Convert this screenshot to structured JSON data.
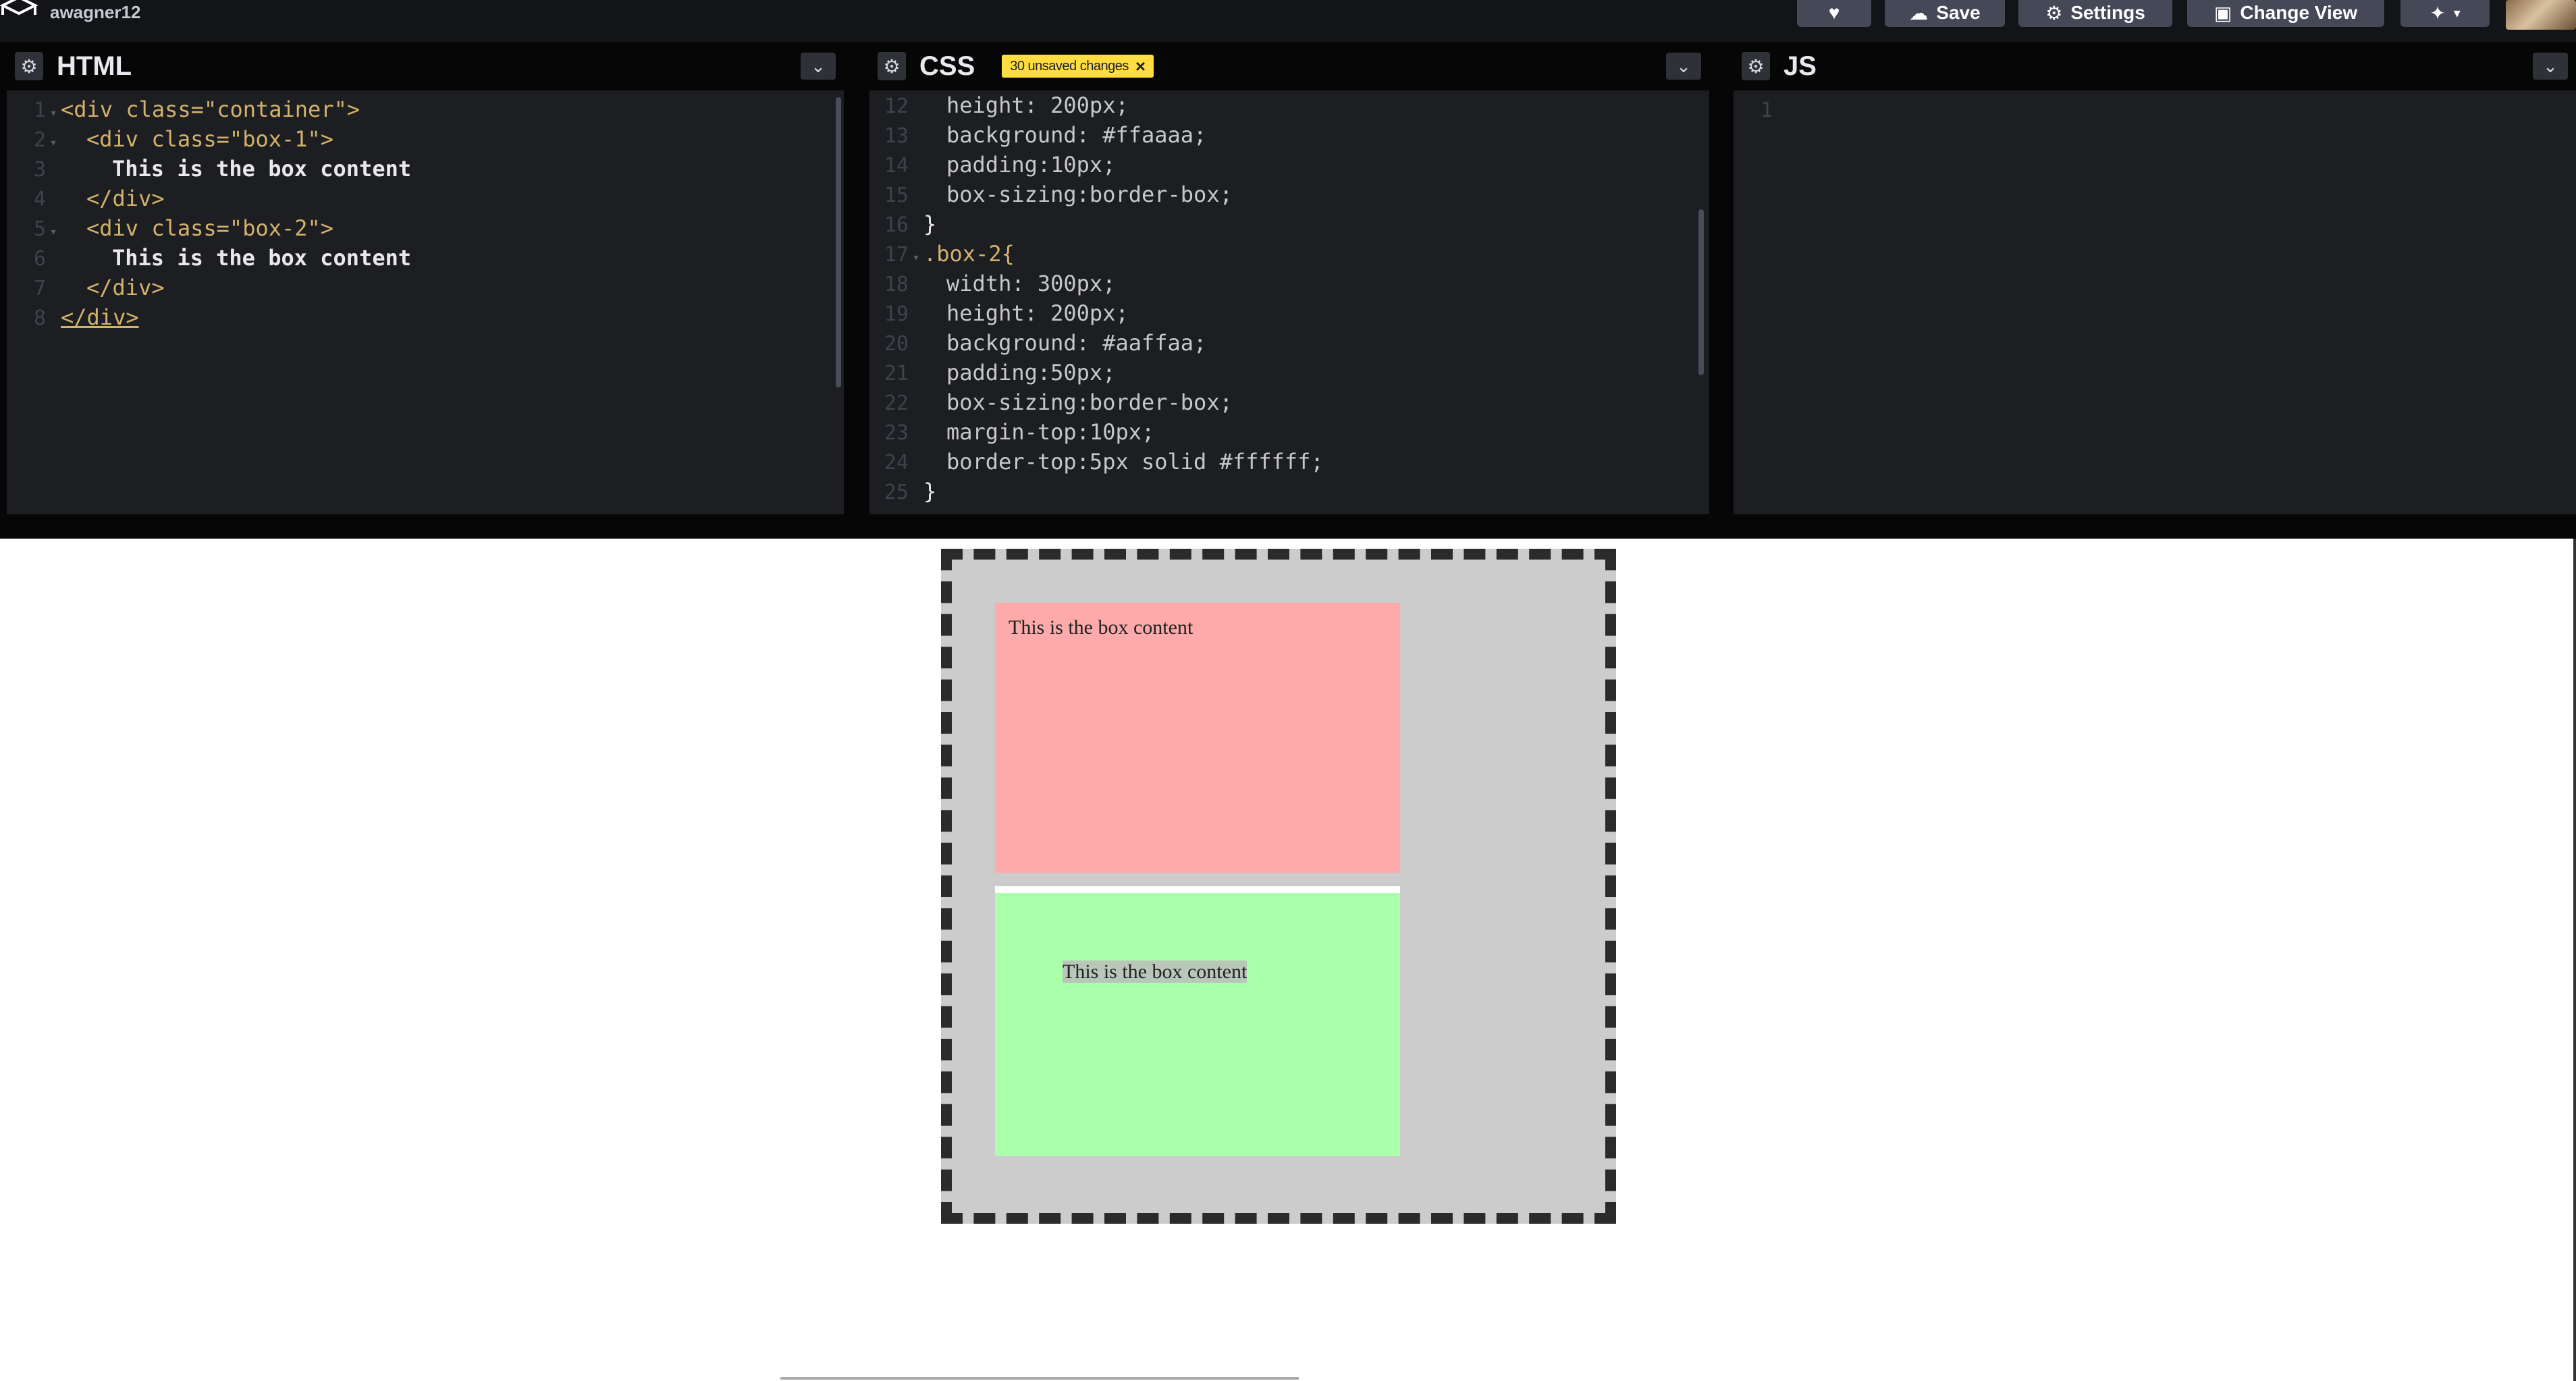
{
  "topbar": {
    "username": "awagner12",
    "save_label": "Save",
    "settings_label": "Settings",
    "change_view_label": "Change View"
  },
  "panels": {
    "html_title": "HTML",
    "css_title": "CSS",
    "js_title": "JS",
    "unsaved_badge": "30 unsaved changes"
  },
  "html_code": [
    {
      "n": "1",
      "text": "<div class=\"container\">"
    },
    {
      "n": "2",
      "text": "<div class=\"box-1\">"
    },
    {
      "n": "3",
      "text": "This is the box content"
    },
    {
      "n": "4",
      "text": "</div>"
    },
    {
      "n": "5",
      "text": "<div class=\"box-2\">"
    },
    {
      "n": "6",
      "text": "This is the box content"
    },
    {
      "n": "7",
      "text": "</div>"
    },
    {
      "n": "8",
      "text": "</div>"
    }
  ],
  "css_code": [
    {
      "n": "12",
      "text": "height: 200px;"
    },
    {
      "n": "13",
      "text": "background: #ffaaaa;"
    },
    {
      "n": "14",
      "text": "padding:10px;"
    },
    {
      "n": "15",
      "text": "box-sizing:border-box;"
    },
    {
      "n": "16",
      "text": "}"
    },
    {
      "n": "17",
      "text": ".box-2{"
    },
    {
      "n": "18",
      "text": "width: 300px;"
    },
    {
      "n": "19",
      "text": "height: 200px;"
    },
    {
      "n": "20",
      "text": "background: #aaffaa;"
    },
    {
      "n": "21",
      "text": "padding:50px;"
    },
    {
      "n": "22",
      "text": "box-sizing:border-box;"
    },
    {
      "n": "23",
      "text": "margin-top:10px;"
    },
    {
      "n": "24",
      "text": "border-top:5px solid #ffffff;"
    },
    {
      "n": "25",
      "text": "}"
    }
  ],
  "js_code": [
    {
      "n": "1",
      "text": ""
    }
  ],
  "preview": {
    "box1_text": "This is the box content",
    "box2_text": "This is the box content"
  },
  "colors": {
    "topbar_bg": "#131417",
    "editor_bg": "#1d1e22",
    "badge_bg": "#ffdd40",
    "box1_bg": "#ffaaaa",
    "box2_bg": "#aaffaa",
    "container_bg": "#cccccc"
  },
  "icons": [
    "logo-icon",
    "heart-icon",
    "cloud-icon",
    "gear-icon",
    "layout-icon",
    "pin-icon",
    "chevron-down-icon",
    "close-icon"
  ]
}
